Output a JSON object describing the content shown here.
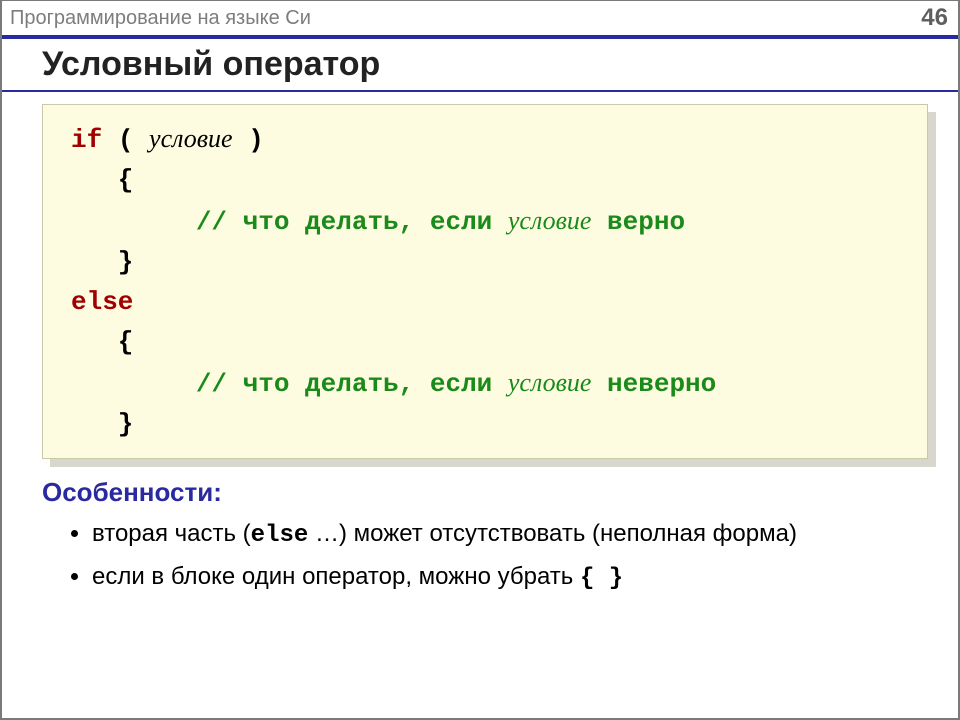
{
  "header": {
    "subject": "Программирование на языке Си",
    "page": "46"
  },
  "title": "Условный оператор",
  "code": {
    "if_kw": "if",
    "open_paren": " ( ",
    "condition": "условие",
    "close_paren": " )",
    "lbrace1": "   {",
    "comment1_prefix": "        // что делать, если ",
    "comment1_cond": "условие",
    "comment1_suffix": " верно",
    "rbrace1": "   }",
    "else_kw": "else",
    "lbrace2": "   {",
    "comment2_prefix": "        // что делать, если ",
    "comment2_cond": "условие",
    "comment2_suffix": " неверно",
    "rbrace2": "   }"
  },
  "features": {
    "heading": "Особенности:",
    "b1_pre": "вторая часть (",
    "b1_else": "else",
    "b1_post": " …) может отсутствовать (неполная форма)",
    "b2_pre": "если в блоке один оператор, можно убрать ",
    "b2_braces": "{ }"
  }
}
